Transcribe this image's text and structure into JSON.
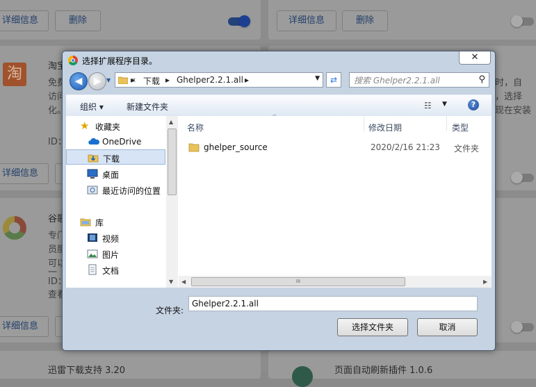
{
  "background": {
    "detail_label": "详细信息",
    "delete_label": "删除",
    "left_cards": [
      {
        "title": "淘宝",
        "lines": [
          "免费",
          "访问",
          "化。"
        ],
        "id_label": "ID："
      },
      {
        "title": "谷歌",
        "lines": [
          "专门",
          "员服",
          "可以",
          "一"
        ],
        "id_label": "ID：",
        "extra": "查看"
      }
    ],
    "right_card_lines": [
      "时，自",
      "，选择",
      "现在安装"
    ],
    "bottom_left_title": "迅雷下载支持   3.20",
    "bottom_right_title": "页面自动刷新插件   1.0.6",
    "logo_glyph": "淘"
  },
  "dialog": {
    "title": "选择扩展程序目录。",
    "close_glyph": "✕",
    "address": {
      "prefix": "«",
      "segments": [
        "下载",
        "Ghelper2.2.1.all"
      ],
      "separator": "▸"
    },
    "search_placeholder": "搜索 Ghelper2.2.1.all",
    "toolbar": {
      "organize_label": "组织 ▾",
      "new_folder_label": "新建文件夹",
      "help_glyph": "?"
    },
    "nav": {
      "favorites_label": "收藏夹",
      "onedrive_label": "OneDrive",
      "downloads_label": "下载",
      "desktop_label": "桌面",
      "recent_label": "最近访问的位置",
      "libraries_label": "库",
      "videos_label": "视频",
      "pictures_label": "图片",
      "documents_label": "文档"
    },
    "columns": {
      "name": "名称",
      "modified": "修改日期",
      "type": "类型"
    },
    "files": [
      {
        "name": "ghelper_source",
        "modified": "2020/2/16 21:23",
        "type": "文件夹"
      }
    ],
    "hscroll_grip": "III",
    "folder_label": "文件夹:",
    "folder_value": "Ghelper2.2.1.all",
    "select_button": "选择文件夹",
    "cancel_button": "取消"
  }
}
